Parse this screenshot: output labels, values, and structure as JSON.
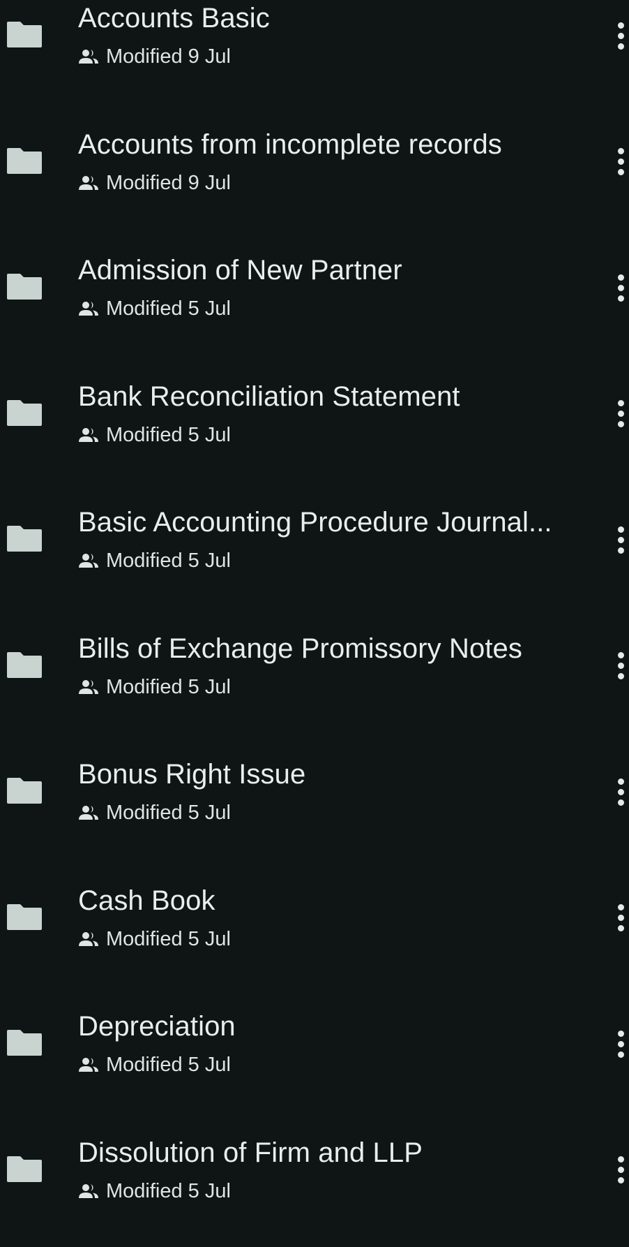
{
  "colors": {
    "background": "#0f1514",
    "folder_icon": "#c9d3cf",
    "title_text": "#e8eeec",
    "meta_text": "#dfe5e3"
  },
  "icons": {
    "folder": "folder-icon",
    "shared": "shared-people-icon",
    "more": "more-vertical-icon"
  },
  "files": [
    {
      "name": "Accounts Basic",
      "modified": "Modified 9 Jul"
    },
    {
      "name": "Accounts from incomplete records",
      "modified": "Modified 9 Jul"
    },
    {
      "name": "Admission of New Partner",
      "modified": "Modified 5 Jul"
    },
    {
      "name": "Bank Reconciliation Statement",
      "modified": "Modified 5 Jul"
    },
    {
      "name": "Basic Accounting Procedure Journal...",
      "modified": "Modified 5 Jul"
    },
    {
      "name": "Bills of Exchange Promissory Notes",
      "modified": "Modified 5 Jul"
    },
    {
      "name": "Bonus Right Issue",
      "modified": "Modified 5 Jul"
    },
    {
      "name": "Cash Book",
      "modified": "Modified 5 Jul"
    },
    {
      "name": "Depreciation",
      "modified": "Modified 5 Jul"
    },
    {
      "name": "Dissolution of Firm and LLP",
      "modified": "Modified 5 Jul"
    }
  ]
}
